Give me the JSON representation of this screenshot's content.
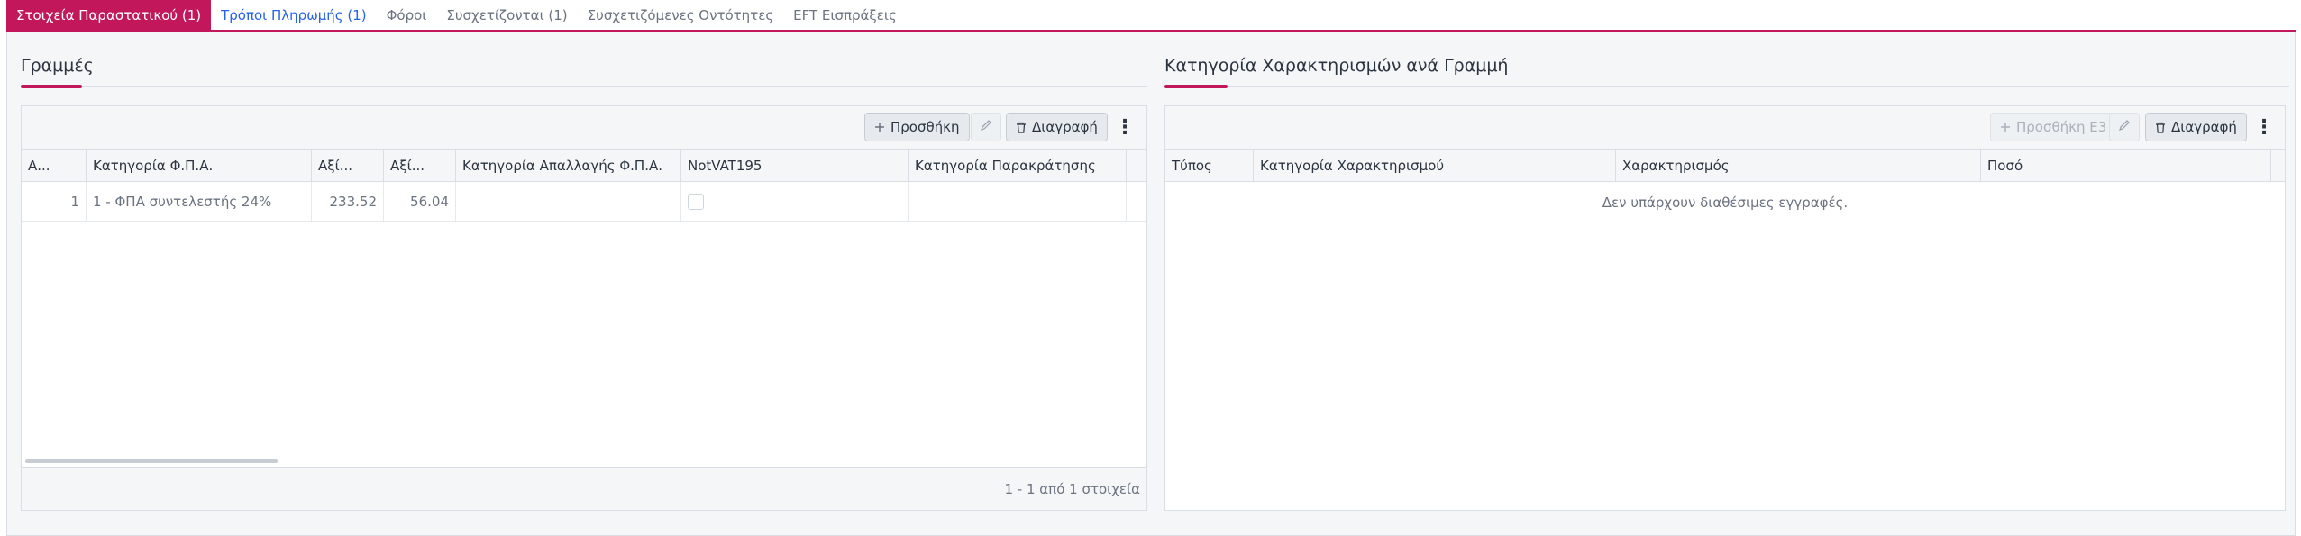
{
  "tabs": [
    {
      "label": "Στοιχεία Παραστατικού (1)"
    },
    {
      "label": "Τρόποι Πληρωμής (1)"
    },
    {
      "label": "Φόροι"
    },
    {
      "label": "Συσχετίζονται (1)"
    },
    {
      "label": "Συσχετιζόμενες Οντότητες"
    },
    {
      "label": "EFT Εισπράξεις"
    }
  ],
  "lines": {
    "title": "Γραμμές",
    "toolbar": {
      "add_label": "Προσθήκη",
      "delete_label": "Διαγραφή"
    },
    "columns": [
      "Α...",
      "Κατηγορία Φ.Π.Α.",
      "Αξί...",
      "Αξί...",
      "Κατηγορία Απαλλαγής Φ.Π.Α.",
      "NotVAT195",
      "Κατηγορία Παρακράτησης"
    ],
    "rows": [
      {
        "aa": "1",
        "vat_category": "1 - ΦΠΑ συντελεστής 24%",
        "value1": "233.52",
        "value2": "56.04",
        "exemption": "",
        "notvat": false,
        "withholding": ""
      }
    ],
    "footer": "1 - 1 από 1 στοιχεία"
  },
  "classifications": {
    "title": "Κατηγορία Χαρακτηρισμών ανά Γραμμή",
    "toolbar": {
      "add_label": "Προσθήκη Ε3",
      "delete_label": "Διαγραφή"
    },
    "columns": [
      "Τύπος",
      "Κατηγορία Χαρακτηρισμού",
      "Χαρακτηρισμός",
      "Ποσό"
    ],
    "empty_text": "Δεν υπάρχουν διαθέσιμες εγγραφές."
  },
  "colors": {
    "accent": "#c2185b",
    "link": "#2563eb"
  },
  "icons": {
    "add": "plus-icon",
    "edit": "pencil-icon",
    "delete": "trash-icon",
    "more": "kebab-icon"
  }
}
